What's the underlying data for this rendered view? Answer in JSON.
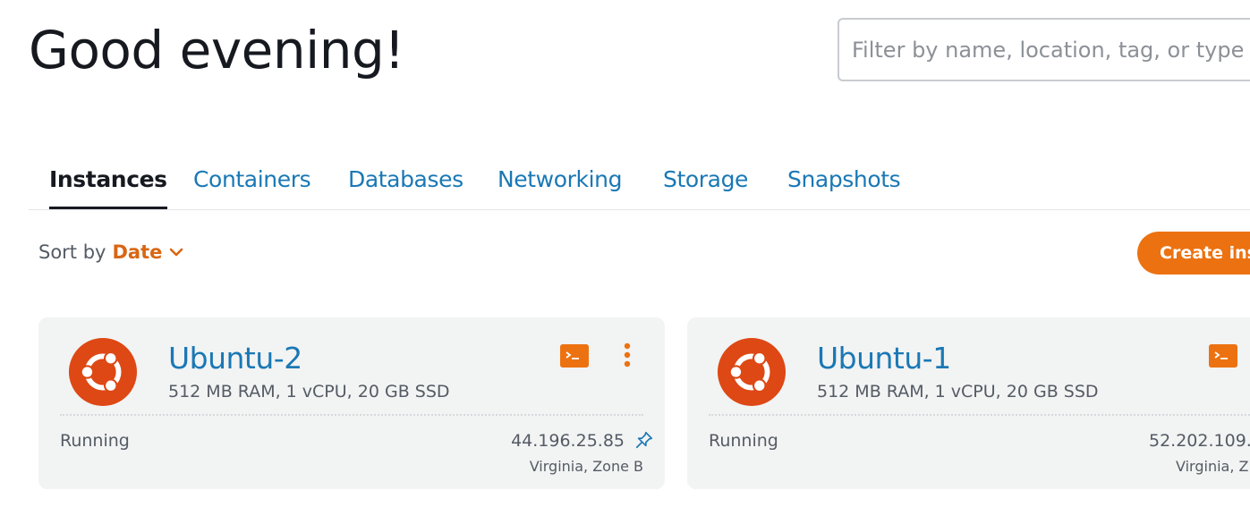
{
  "header": {
    "greeting": "Good evening!",
    "search_placeholder": "Filter by name, location, tag, or type"
  },
  "tabs": [
    {
      "label": "Instances",
      "active": true
    },
    {
      "label": "Containers",
      "active": false
    },
    {
      "label": "Databases",
      "active": false
    },
    {
      "label": "Networking",
      "active": false
    },
    {
      "label": "Storage",
      "active": false
    },
    {
      "label": "Snapshots",
      "active": false
    }
  ],
  "sort": {
    "label": "Sort by",
    "value": "Date",
    "icon": "chevron-down-icon"
  },
  "create_button": {
    "label": "Create inst"
  },
  "instances": [
    {
      "name": "Ubuntu-2",
      "specs": "512 MB RAM, 1 vCPU, 20 GB SSD",
      "status": "Running",
      "ip": "44.196.25.85",
      "region": "Virginia, Zone B",
      "logo": "ubuntu-logo-icon"
    },
    {
      "name": "Ubuntu-1",
      "specs": "512 MB RAM, 1 vCPU, 20 GB SSD",
      "status": "Running",
      "ip": "52.202.109.",
      "region": "Virginia, Z",
      "logo": "ubuntu-logo-icon"
    }
  ],
  "colors": {
    "accent_orange": "#ec7211",
    "link_blue": "#1a78b5",
    "ubuntu_orange": "#dd4814",
    "card_bg": "#f2f3f3",
    "text_dark": "#16191f",
    "text_muted": "#545b64"
  }
}
